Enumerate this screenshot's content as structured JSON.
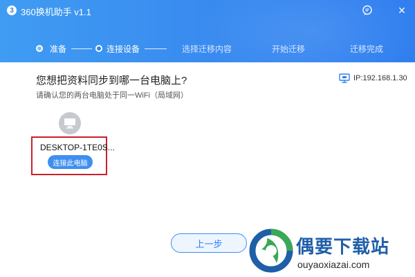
{
  "app": {
    "logo_glyph": "3",
    "title": "360换机助手 v1.1",
    "icons": {
      "feedback": "chat-bubble-icon",
      "close": "close-icon"
    },
    "close_glyph": "×"
  },
  "steps": [
    {
      "label": "准备",
      "state": "done"
    },
    {
      "label": "连接设备",
      "state": "active"
    },
    {
      "label": "选择迁移内容",
      "state": "pending"
    },
    {
      "label": "开始迁移",
      "state": "pending"
    },
    {
      "label": "迁移完成",
      "state": "pending"
    }
  ],
  "main": {
    "question": "您想把资料同步到哪一台电脑上?",
    "hint": "请确认您的两台电脑处于同一WiFi（局域网）",
    "ip": {
      "icon": "monitor-icon",
      "label": "IP:192.168.1.30"
    }
  },
  "device": {
    "icon": "computer-icon",
    "name": "DESKTOP-1TE0S...",
    "connect_label": "连接此电脑"
  },
  "footer": {
    "prev_label": "上一步"
  },
  "watermark": {
    "title": "偶要下载站",
    "url": "ouyaoxiazai.com"
  },
  "colors": {
    "header": "#3a8cf0",
    "accent": "#3f8ff0",
    "highlight_border": "#cc1f2a",
    "watermark_blue": "#1f5fa8"
  }
}
